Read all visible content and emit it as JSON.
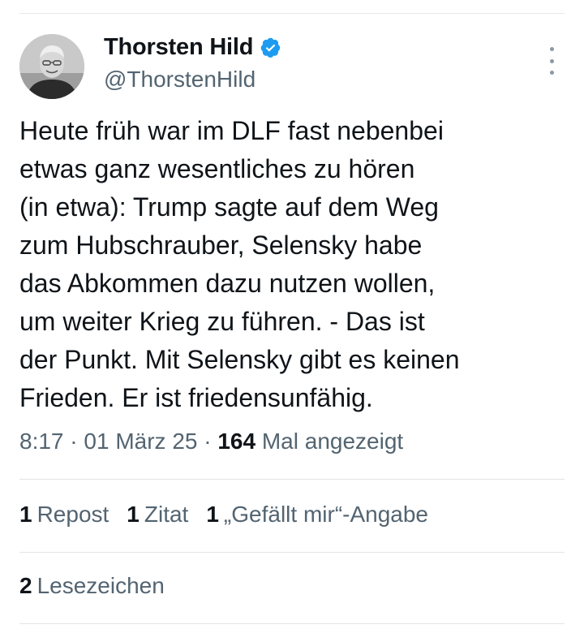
{
  "author": {
    "display_name": "Thorsten Hild",
    "handle": "@ThorstenHild",
    "verified_color": "#1d9bf0"
  },
  "tweet": {
    "text": "Heute früh war im DLF fast nebenbei\netwas ganz wesentliches zu hören\n(in etwa): Trump sagte auf dem Weg\nzum Hubschrauber, Selensky habe\ndas Abkommen dazu nutzen wollen,\num weiter Krieg zu führen. - Das ist\nder Punkt. Mit Selensky gibt es keinen\nFrieden. Er ist friedensunfähig."
  },
  "meta": {
    "time": "8:17",
    "date": "01 März 25",
    "separator": "·",
    "views_count": "164",
    "views_label": "Mal angezeigt"
  },
  "stats": {
    "reposts": {
      "count": "1",
      "label": "Repost"
    },
    "quotes": {
      "count": "1",
      "label": "Zitat"
    },
    "likes": {
      "count": "1",
      "label": "„Gefällt mir“-Angabe"
    },
    "bookmarks": {
      "count": "2",
      "label": "Lesezeichen"
    }
  },
  "icons": {
    "avatar": "avatar-photo",
    "verified": "verified-badge-icon",
    "more": "more-vertical-icon"
  }
}
